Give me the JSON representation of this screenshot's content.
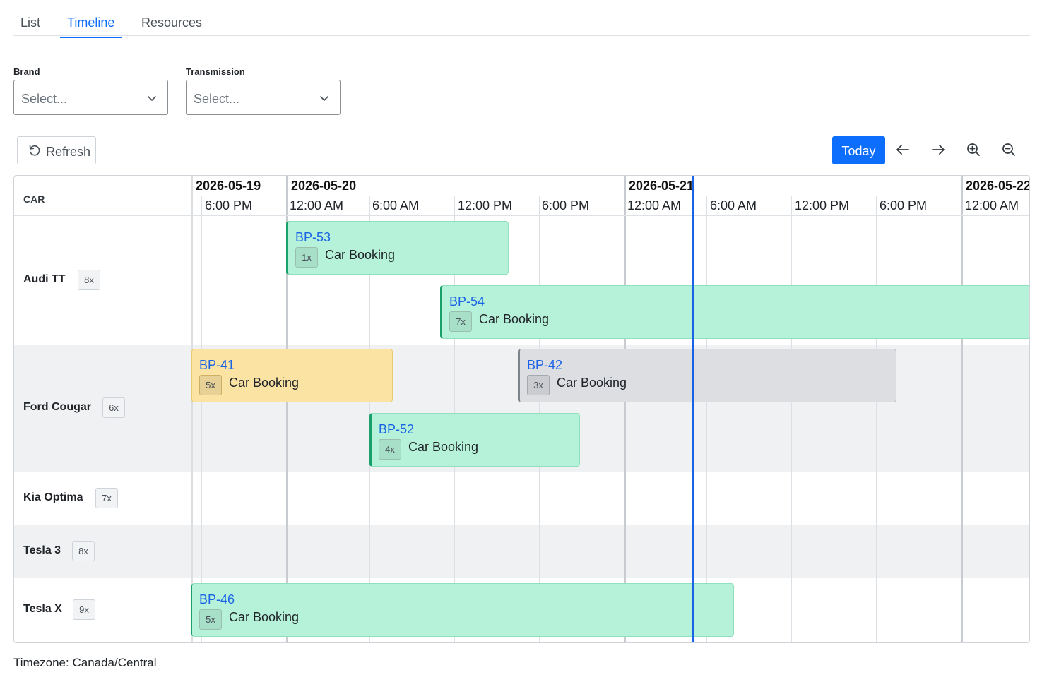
{
  "tabs": [
    {
      "label": "List",
      "active": false
    },
    {
      "label": "Timeline",
      "active": true
    },
    {
      "label": "Resources",
      "active": false
    }
  ],
  "filters": {
    "brand": {
      "label": "Brand",
      "placeholder": "Select..."
    },
    "transmission": {
      "label": "Transmission",
      "placeholder": "Select..."
    }
  },
  "toolbar": {
    "refresh_label": "Refresh",
    "today_label": "Today",
    "icons": [
      "arrow-left-icon",
      "arrow-right-icon",
      "zoom-in-icon",
      "zoom-out-icon"
    ],
    "accent_color": "#0d6efd"
  },
  "timeline": {
    "resource_header": "CAR",
    "dates": [
      "2026-05-19",
      "2026-05-20",
      "2026-05-21",
      "2026-05-22"
    ],
    "times": [
      "6:00 PM",
      "12:00 AM",
      "6:00 AM",
      "12:00 PM",
      "6:00 PM",
      "12:00 AM",
      "6:00 AM",
      "12:00 PM",
      "6:00 PM",
      "12:00 AM"
    ],
    "resources": [
      {
        "name": "Audi TT",
        "count": "8x"
      },
      {
        "name": "Ford Cougar",
        "count": "6x"
      },
      {
        "name": "Kia Optima",
        "count": "7x"
      },
      {
        "name": "Tesla 3",
        "count": "8x"
      },
      {
        "name": "Tesla X",
        "count": "9x"
      }
    ],
    "events": [
      {
        "code": "BP-53",
        "qty": "1x",
        "title": "Car Booking",
        "resource": "Audi TT",
        "color": "#b6f2da"
      },
      {
        "code": "BP-54",
        "qty": "7x",
        "title": "Car Booking",
        "resource": "Audi TT",
        "color": "#b6f2da"
      },
      {
        "code": "BP-41",
        "qty": "5x",
        "title": "Car Booking",
        "resource": "Ford Cougar",
        "color": "#fbe3a4"
      },
      {
        "code": "BP-42",
        "qty": "3x",
        "title": "Car Booking",
        "resource": "Ford Cougar",
        "color": "#dcdee2"
      },
      {
        "code": "BP-52",
        "qty": "4x",
        "title": "Car Booking",
        "resource": "Ford Cougar",
        "color": "#b6f2da"
      },
      {
        "code": "BP-46",
        "qty": "5x",
        "title": "Car Booking",
        "resource": "Tesla X",
        "color": "#b6f2da"
      }
    ],
    "now_line_color": "#1a63e6"
  },
  "footer": {
    "timezone": "Timezone: Canada/Central"
  }
}
